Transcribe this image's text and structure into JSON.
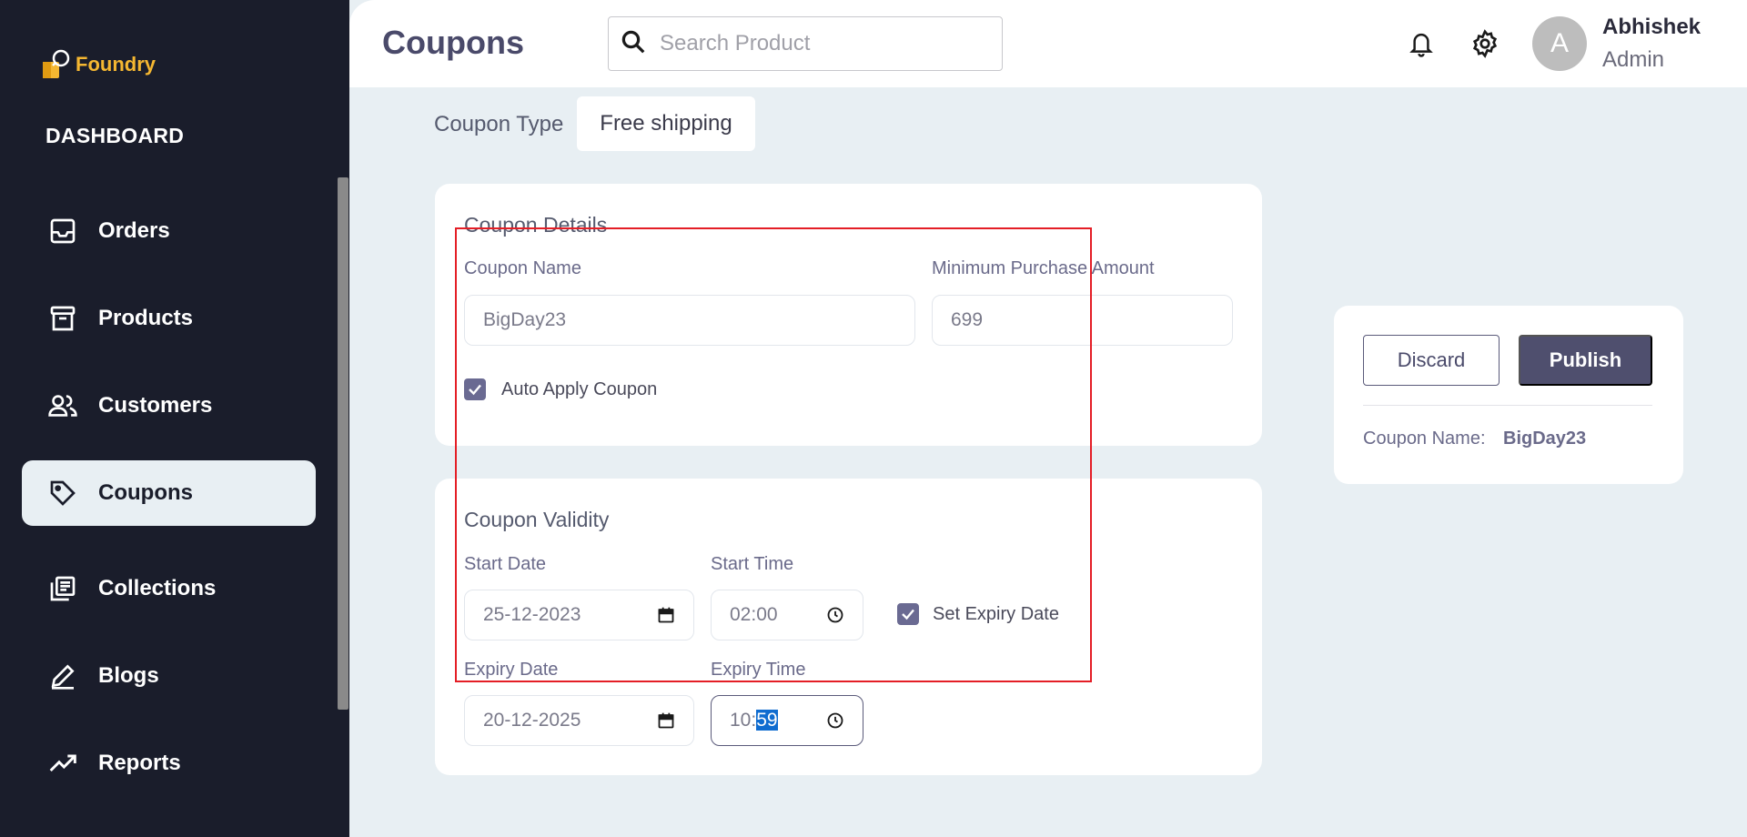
{
  "brand": {
    "name": "Foundry"
  },
  "sidebar": {
    "section_label": "DASHBOARD",
    "items": [
      {
        "label": "Orders",
        "icon": "inbox-icon"
      },
      {
        "label": "Products",
        "icon": "archive-icon"
      },
      {
        "label": "Customers",
        "icon": "users-icon"
      },
      {
        "label": "Coupons",
        "icon": "tag-icon",
        "active": true
      },
      {
        "label": "Collections",
        "icon": "library-icon"
      },
      {
        "label": "Blogs",
        "icon": "edit-icon"
      },
      {
        "label": "Reports",
        "icon": "trending-up-icon"
      }
    ]
  },
  "header": {
    "title": "Coupons",
    "search": {
      "placeholder": "Search Product",
      "value": ""
    },
    "user": {
      "initial": "A",
      "name": "Abhishek",
      "role": "Admin"
    }
  },
  "coupon_type": {
    "label": "Coupon Type",
    "value": "Free shipping"
  },
  "details": {
    "title": "Coupon Details",
    "name_label": "Coupon Name",
    "name_value": "BigDay23",
    "min_label": "Minimum Purchase Amount",
    "min_value": "699",
    "auto_apply_label": "Auto Apply Coupon",
    "auto_apply_checked": true
  },
  "validity": {
    "title": "Coupon Validity",
    "start_date_label": "Start Date",
    "start_date_value": "25-12-2023",
    "start_time_label": "Start Time",
    "start_time_value": "02:00",
    "set_expiry_label": "Set Expiry Date",
    "set_expiry_checked": true,
    "expiry_date_label": "Expiry Date",
    "expiry_date_value": "20-12-2025",
    "expiry_time_label": "Expiry Time",
    "expiry_time_hour": "10:",
    "expiry_time_minute": "59"
  },
  "summary": {
    "discard_label": "Discard",
    "publish_label": "Publish",
    "name_label": "Coupon Name:",
    "name_value": "BigDay23"
  },
  "colors": {
    "sidebar_bg": "#1a1d2b",
    "brand": "#f5b731",
    "accent": "#4f4f6e",
    "highlight": "#e41e26",
    "page_bg": "#e8eff3"
  }
}
